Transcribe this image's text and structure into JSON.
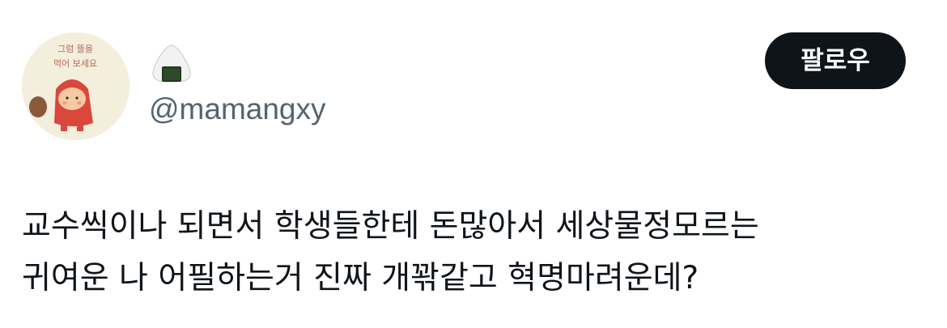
{
  "tweet": {
    "author": {
      "display_name_icon": "onigiri-emoji",
      "handle": "@mamangxy",
      "avatar_caption": "그럼 뜰을 먹어 보세요"
    },
    "follow_label": "팔로우",
    "text": "교수씩이나 되면서 학생들한테 돈많아서 세상물정모르는\n귀여운 나 어필하는거 진짜 개꽊같고 혁명마려운데?"
  },
  "colors": {
    "text_primary": "#0f1419",
    "text_secondary": "#536471",
    "button_bg": "#0f1419",
    "button_text": "#ffffff"
  }
}
